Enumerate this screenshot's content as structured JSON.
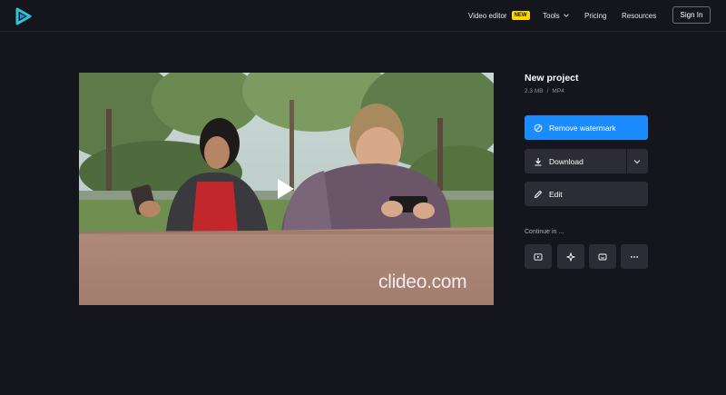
{
  "header": {
    "nav": {
      "video_editor": "Video editor",
      "new_badge": "NEW",
      "tools": "Tools",
      "pricing": "Pricing",
      "resources": "Resources"
    },
    "sign_in": "Sign In"
  },
  "video": {
    "watermark": "clideo.com"
  },
  "project": {
    "title": "New project",
    "size": "2.3 MB",
    "separator": "/",
    "format": "MP4"
  },
  "actions": {
    "remove_watermark": "Remove watermark",
    "download": "Download",
    "edit": "Edit"
  },
  "continue": {
    "label": "Continue in ...",
    "icons": [
      "video-player-icon",
      "sparkle-icon",
      "subtitles-icon",
      "more-icon"
    ]
  },
  "colors": {
    "background": "#15151d",
    "accent": "#1a8cff",
    "button_dark": "#2c2c36",
    "badge": "#ffd600",
    "logo": "#2bc6d6"
  }
}
